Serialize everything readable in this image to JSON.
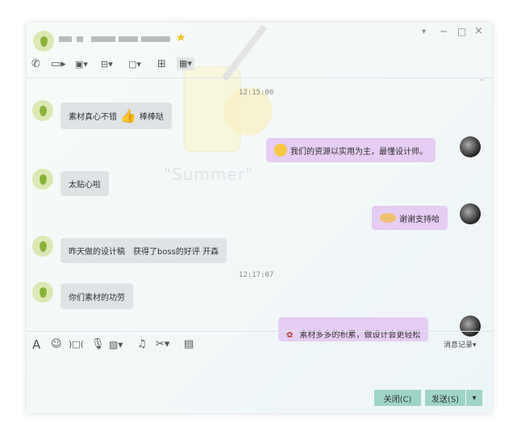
{
  "header": {
    "contact_name_blurred": "",
    "star_icon": "star-icon"
  },
  "window_controls": {
    "menu": "▾",
    "minimize": "−",
    "maximize": "□",
    "close": "×"
  },
  "toolbar_top": [
    "phone-icon",
    "video-icon",
    "screen-share-icon",
    "file-transfer-icon",
    "remote-desktop-icon",
    "add-app-icon",
    "apps-grid-icon"
  ],
  "background_text": "\"Summer\"",
  "messages": [
    {
      "type": "time",
      "text": "12:15:00"
    },
    {
      "side": "left",
      "text_a": "素材真心不错",
      "text_b": "棒棒哒"
    },
    {
      "side": "right",
      "text": "我们的资源以实用为主，最懂设计师。"
    },
    {
      "side": "left",
      "text": "太贴心啦"
    },
    {
      "side": "right",
      "text": "谢谢支持哈"
    },
    {
      "side": "left",
      "text": "昨天做的设计稿　获得了boss的好评 开森"
    },
    {
      "type": "time",
      "text": "12:17:07"
    },
    {
      "side": "left",
      "text": "你们素材的功劳"
    },
    {
      "side": "right",
      "text": "素材多多的积累，做设计会更轻松"
    }
  ],
  "input_toolbar": {
    "history_label": "消息记录",
    "dropdown": "▾"
  },
  "buttons": {
    "close": "关闭(C)",
    "send": "发送(S)",
    "send_menu": "▾"
  }
}
